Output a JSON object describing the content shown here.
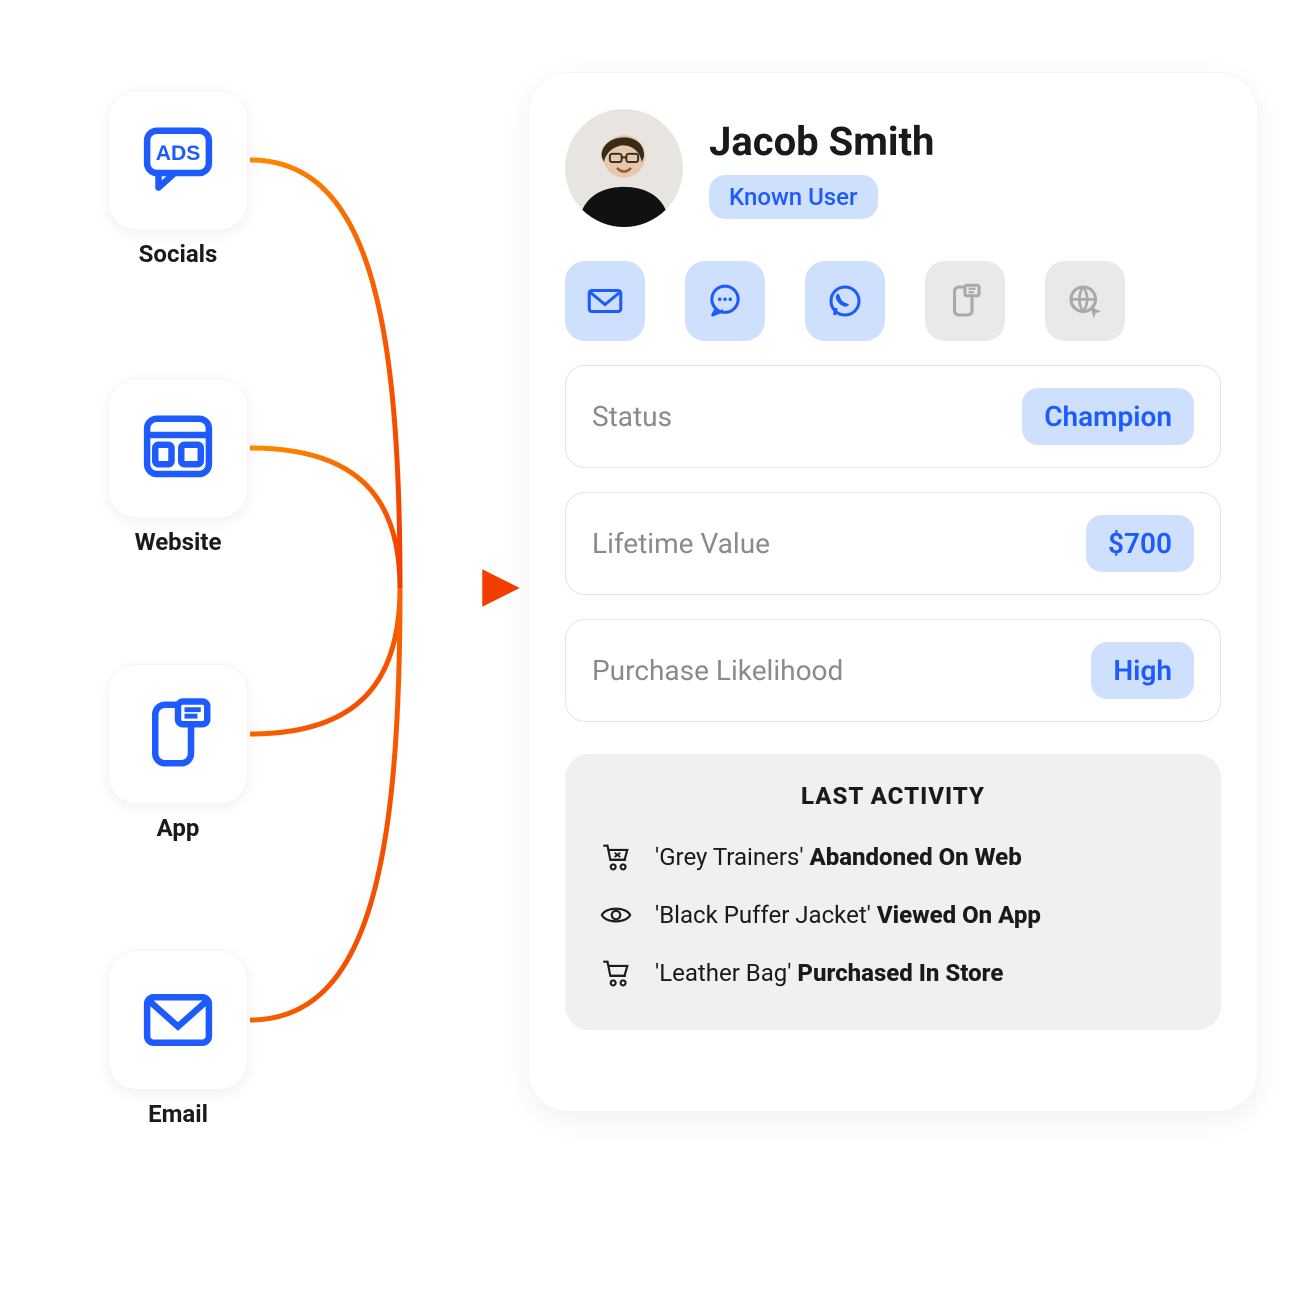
{
  "sources": {
    "items": [
      {
        "label": "Socials",
        "icon": "ads"
      },
      {
        "label": "Website",
        "icon": "website"
      },
      {
        "label": "App",
        "icon": "app"
      },
      {
        "label": "Email",
        "icon": "email"
      }
    ]
  },
  "profile": {
    "name": "Jacob Smith",
    "badge": "Known User"
  },
  "channels": [
    {
      "name": "email",
      "active": true
    },
    {
      "name": "chat",
      "active": true
    },
    {
      "name": "whatsapp",
      "active": true
    },
    {
      "name": "sms",
      "active": false
    },
    {
      "name": "web",
      "active": false
    }
  ],
  "stats": {
    "status": {
      "label": "Status",
      "value": "Champion"
    },
    "ltv": {
      "label": "Lifetime Value",
      "value": "$700"
    },
    "purchase": {
      "label": "Purchase Likelihood",
      "value": "High"
    }
  },
  "activity": {
    "title": "LAST ACTIVITY",
    "items": [
      {
        "product": "'Grey Trainers'",
        "action": "Abandoned On Web",
        "icon": "cart-x"
      },
      {
        "product": "'Black Puffer Jacket'",
        "action": "Viewed On App",
        "icon": "eye"
      },
      {
        "product": "'Leather Bag'",
        "action": "Purchased In Store",
        "icon": "cart"
      }
    ]
  },
  "colors": {
    "accent": "#1d5bff",
    "accentSoft": "#cfe0ff",
    "connector": "#f56a00"
  }
}
